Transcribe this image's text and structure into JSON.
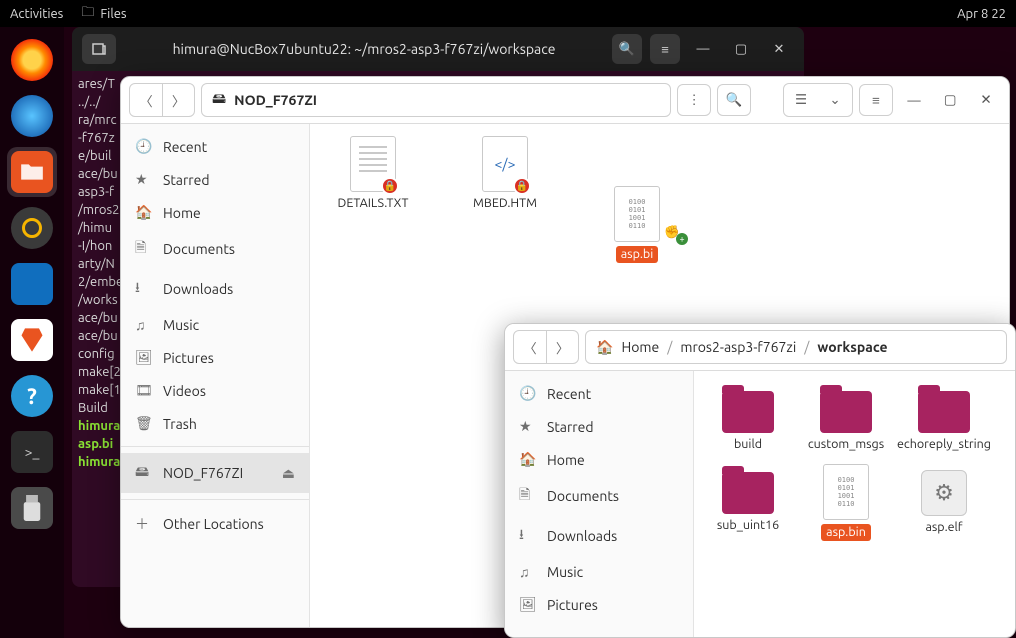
{
  "topbar": {
    "activities": "Activities",
    "files": "Files",
    "clock": "Apr 8  22"
  },
  "terminal": {
    "title": "himura@NucBox7ubuntu22: ~/mros2-asp3-f767zi/workspace",
    "lines": [
      "ares/T",
      "../../",
      "ra/mrc",
      "-f767z",
      "e/buil",
      "ace/bu",
      "asp3-f",
      "/mros2",
      "/himu",
      "-I/hon",
      "arty/N",
      "2/embe",
      "/works",
      "ace/bu",
      "ace/bu",
      "",
      "config",
      "make[2",
      "make[1",
      "Build"
    ],
    "green1": "himura",
    "green2": "asp.bi",
    "green3": "himura"
  },
  "fm1": {
    "location": "NOD_F767ZI",
    "sidebar": [
      "Recent",
      "Starred",
      "Home",
      "Documents",
      "Downloads",
      "Music",
      "Pictures",
      "Videos",
      "Trash",
      "NOD_F767ZI",
      "Other Locations"
    ],
    "files": {
      "details": "DETAILS.TXT",
      "mbed": "MBED.HTM",
      "asp": "asp.bi"
    }
  },
  "fm2": {
    "crumbs": [
      "Home",
      "mros2-asp3-f767zi",
      "workspace"
    ],
    "sidebar": [
      "Recent",
      "Starred",
      "Home",
      "Documents",
      "Downloads",
      "Music",
      "Pictures"
    ],
    "files": {
      "build": "build",
      "custom": "custom_msgs",
      "echo": "echoreply_string",
      "sub": "sub_uint16",
      "aspbin": "asp.bin",
      "aspelf": "asp.elf"
    }
  },
  "bin_text": "0100\n0101\n1001\n0110"
}
